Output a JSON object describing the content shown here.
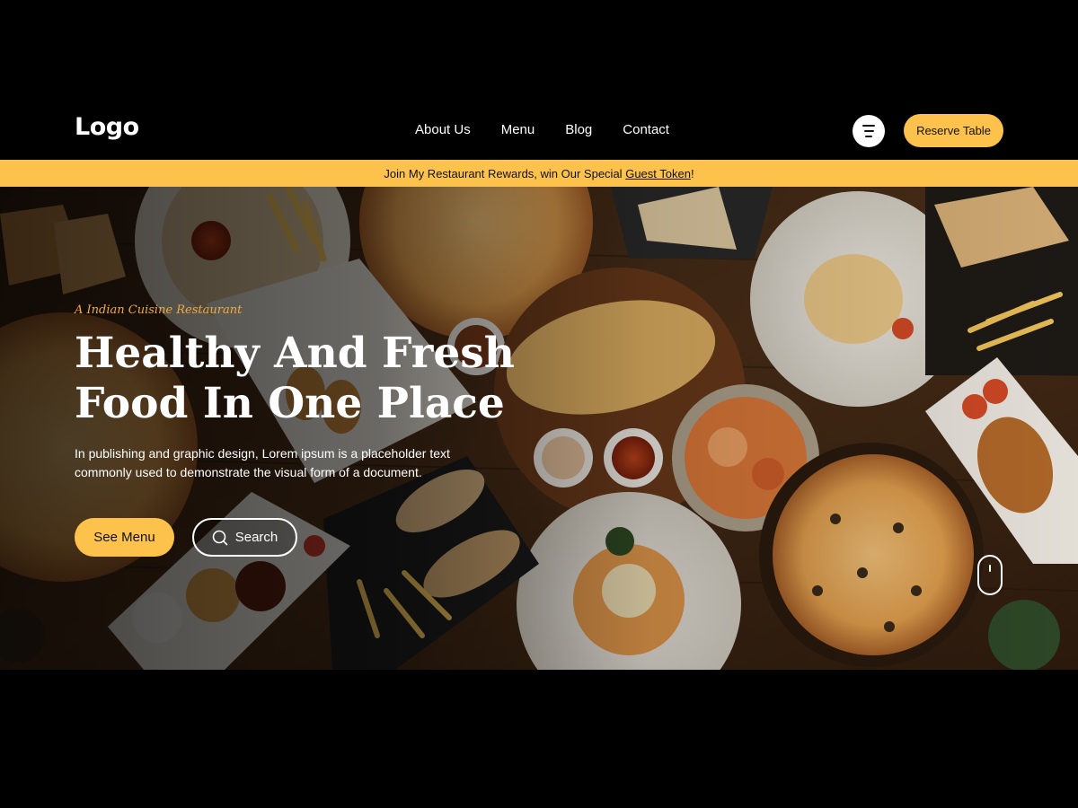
{
  "header": {
    "logo": "Logo",
    "nav": [
      "About Us",
      "Menu",
      "Blog",
      "Contact"
    ],
    "menu_icon": "hamburger-menu-icon",
    "reserve_label": "Reserve Table"
  },
  "promo": {
    "text_before": "Join My Restaurant Rewards, win Our Special ",
    "link_text": "Guest Token",
    "text_after": "!"
  },
  "hero": {
    "tagline": "A Indian Cuisine Restaurant",
    "headline_line1": "Healthy And Fresh",
    "headline_line2": "Food In One Place",
    "description": "In publishing and graphic design, Lorem ipsum is a placeholder text commonly used to demonstrate the visual form of a document.",
    "see_menu_label": "See Menu",
    "search_label": "Search",
    "search_icon": "search-icon",
    "scroll_icon": "mouse-scroll-icon"
  },
  "colors": {
    "accent": "#fcc24b",
    "tagline": "#f2a93b",
    "background": "#000000"
  }
}
